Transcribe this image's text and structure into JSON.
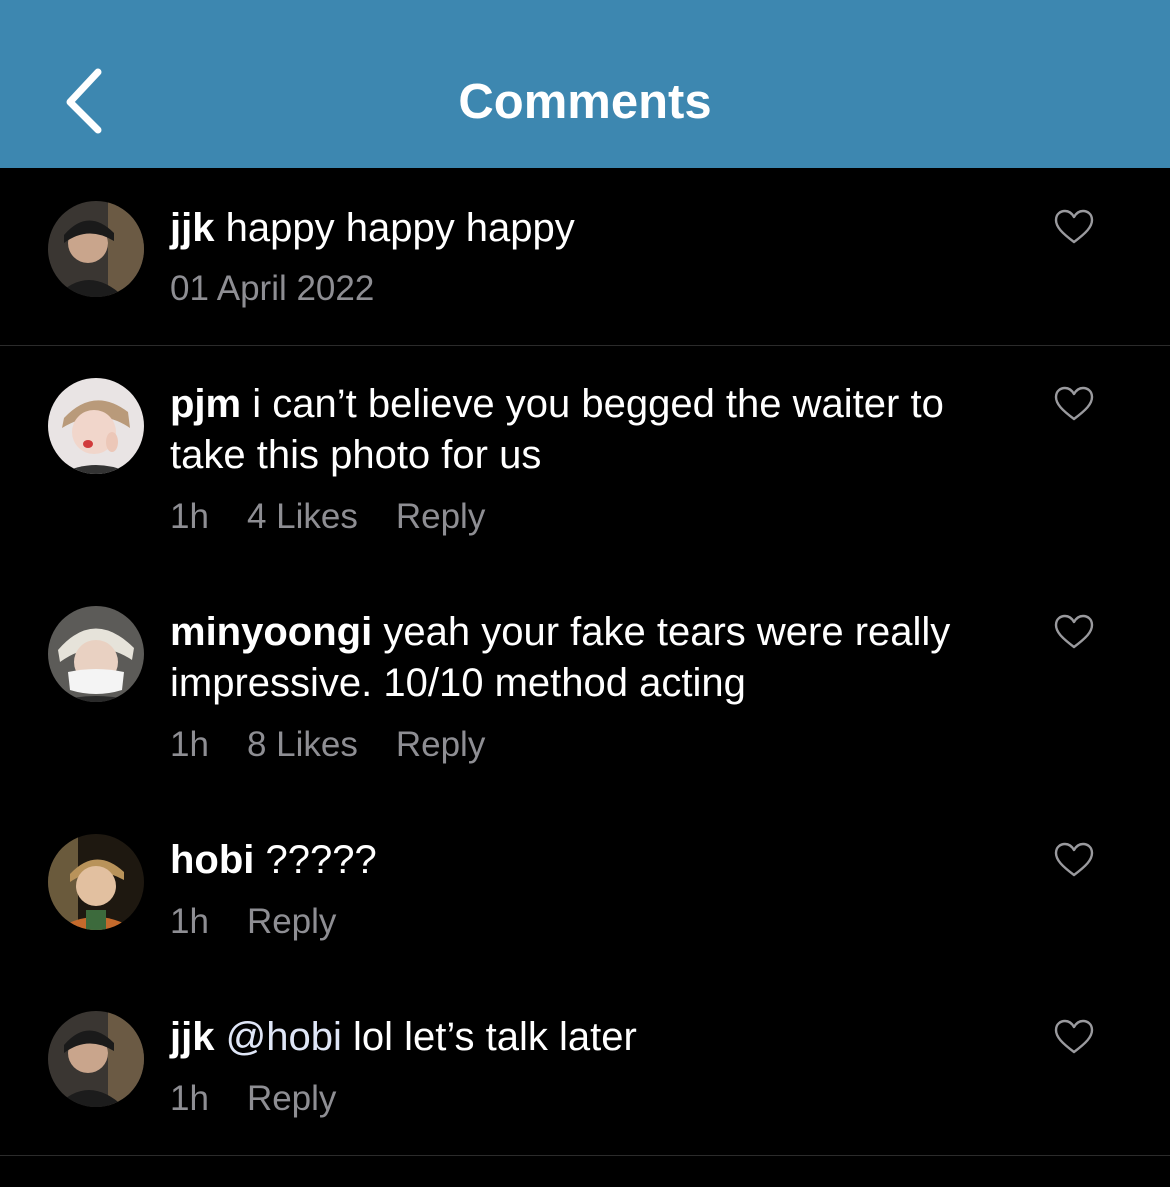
{
  "header": {
    "title": "Comments",
    "back_icon": "chevron-left-icon",
    "background_color": "#3d87b0"
  },
  "comments": [
    {
      "username": "jjk",
      "text": "happy happy happy",
      "date": "01 April 2022",
      "like_icon": "heart-outline-icon"
    },
    {
      "username": "pjm",
      "text": "i can’t believe you begged the waiter to take this photo for us",
      "time": "1h",
      "likes": "4 Likes",
      "reply": "Reply",
      "like_icon": "heart-outline-icon"
    },
    {
      "username": "minyoongi",
      "text": "yeah your fake tears were really impressive. 10/10 method acting",
      "time": "1h",
      "likes": "8 Likes",
      "reply": "Reply",
      "like_icon": "heart-outline-icon"
    },
    {
      "username": "hobi",
      "text": "?????",
      "time": "1h",
      "reply": "Reply",
      "like_icon": "heart-outline-icon"
    },
    {
      "username": "jjk",
      "mention": "@hobi",
      "text": "lol let’s talk later",
      "time": "1h",
      "reply": "Reply",
      "like_icon": "heart-outline-icon"
    }
  ]
}
